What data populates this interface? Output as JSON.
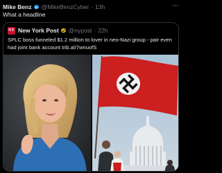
{
  "tweet": {
    "author_name": "Mike Benz",
    "handle": "@MikeBenzCyber",
    "separator": "·",
    "time": "13h",
    "text": "What a headline",
    "more_icon": "more-icon"
  },
  "quote": {
    "author_name": "New York Post",
    "handle": "@nypost",
    "separator": "·",
    "time": "22h",
    "logo_text": "NY",
    "text": "SPLC boss funneled $1.2 million to lover in neo-Nazi group - pair even had joint bank account trib.al/7wnuofS"
  },
  "colors": {
    "background": "#000000",
    "text": "#e7e9ea",
    "muted": "#71767b",
    "verified_blue": "#1d9bf0",
    "verified_gold": "#e2b719",
    "nyp_red": "#c8102e",
    "flag_red": "#cc1f1f"
  }
}
